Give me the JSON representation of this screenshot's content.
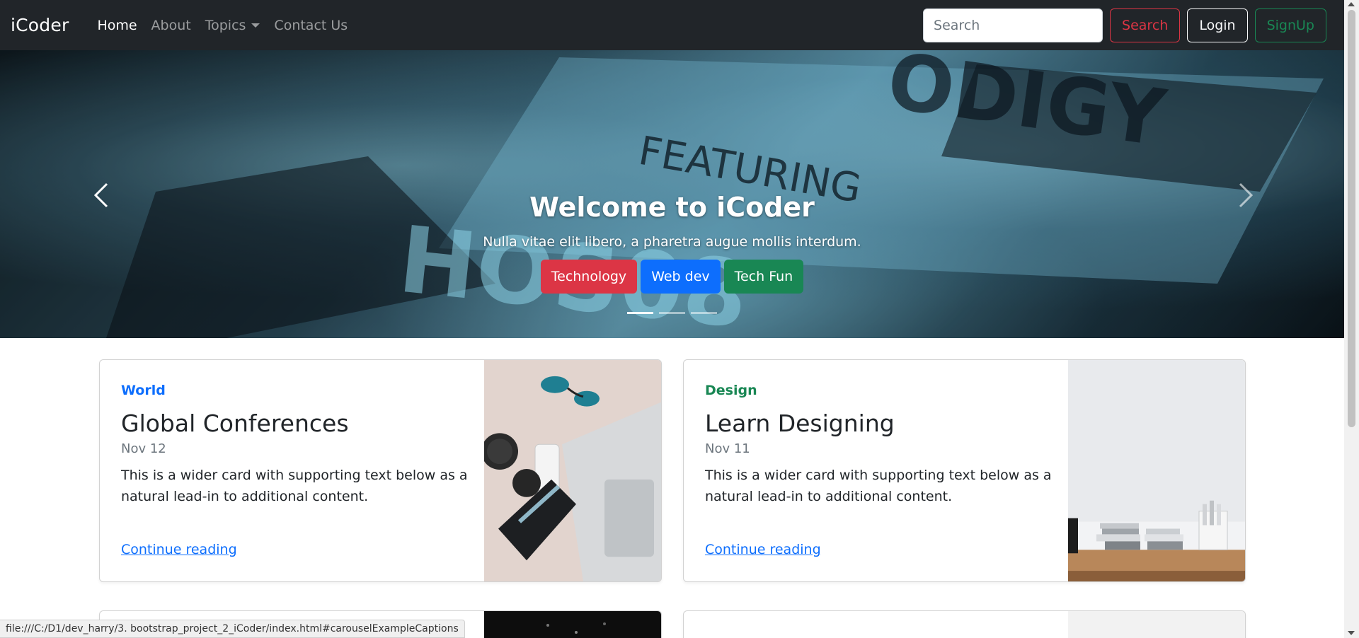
{
  "navbar": {
    "brand": "iCoder",
    "links": [
      "Home",
      "About",
      "Topics",
      "Contact Us"
    ],
    "search_placeholder": "Search",
    "search_button": "Search",
    "login": "Login",
    "signup": "SignUp"
  },
  "carousel": {
    "title": "Welcome to iCoder",
    "subtitle": "Nulla vitae elit libero, a pharetra augue mollis interdum.",
    "buttons": [
      "Technology",
      "Web dev",
      "Tech Fun"
    ],
    "slide_count": 3,
    "active_slide": 1
  },
  "cards": [
    {
      "category": "World",
      "title": "Global Conferences",
      "date": "Nov 12",
      "text": "This is a wider card with supporting text below as a natural lead-in to additional content.",
      "link": "Continue reading"
    },
    {
      "category": "Design",
      "title": "Learn Designing",
      "date": "Nov 11",
      "text": "This is a wider card with supporting text below as a natural lead-in to additional content.",
      "link": "Continue reading"
    }
  ],
  "status_url": "file:///C:/D1/dev_harry/3. bootstrap_project_2_iCoder/index.html#carouselExampleCaptions",
  "colors": {
    "navbar_bg": "#212529",
    "danger": "#dc3545",
    "primary": "#0d6efd",
    "success": "#198754"
  }
}
